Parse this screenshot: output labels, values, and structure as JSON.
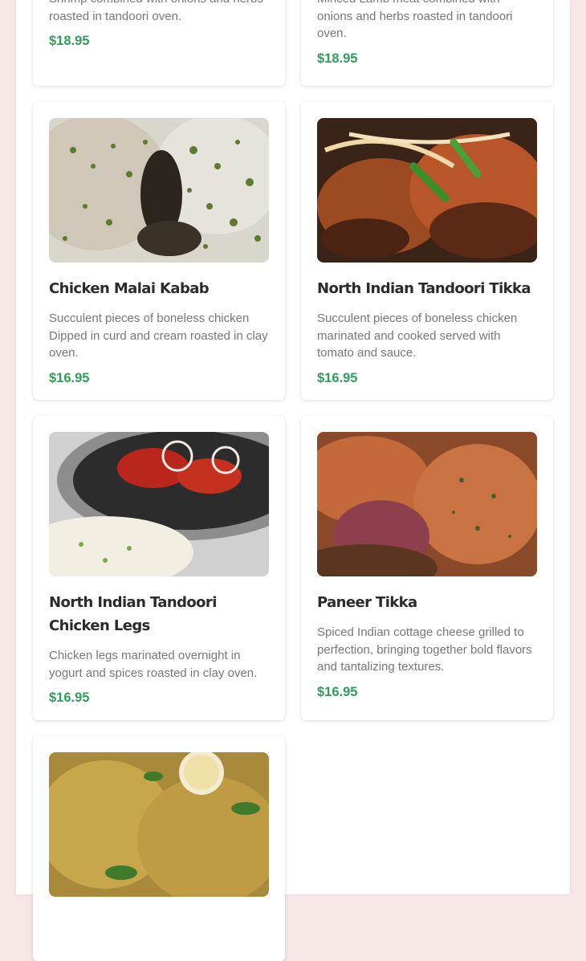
{
  "items": [
    {
      "title": "",
      "description": "Shrimp combined with onions and herbs roasted in tandoori oven.",
      "price": "$18.95",
      "image_icon": "food-image"
    },
    {
      "title": "",
      "description": "Minced Lamb meat combined with onions and herbs roasted in tandoori oven.",
      "price": "$18.95",
      "image_icon": "food-image"
    },
    {
      "title": "Chicken Malai Kabab",
      "description": "Succulent pieces of boneless chicken Dipped in curd and cream roasted in clay oven.",
      "price": "$16.95",
      "image_icon": "food-image"
    },
    {
      "title": "North Indian Tandoori Tikka",
      "description": "Succulent pieces of boneless chicken marinated and cooked served with tomato and sauce.",
      "price": "$16.95",
      "image_icon": "food-image"
    },
    {
      "title": "North Indian Tandoori Chicken Legs",
      "description": "Chicken legs marinated overnight in yogurt and spices roasted in clay oven.",
      "price": "$16.95",
      "image_icon": "food-image"
    },
    {
      "title": "Paneer Tikka",
      "description": "Spiced Indian cottage cheese grilled to perfection, bringing together bold flavors and tantalizing textures.",
      "price": "$16.95",
      "image_icon": "food-image"
    },
    {
      "title": "",
      "description": "",
      "price": "",
      "image_icon": "food-image"
    }
  ],
  "colors": {
    "page_background": "#f6e6e6",
    "price": "#2e9e58",
    "title": "#2b2b2b",
    "description": "#777777"
  }
}
